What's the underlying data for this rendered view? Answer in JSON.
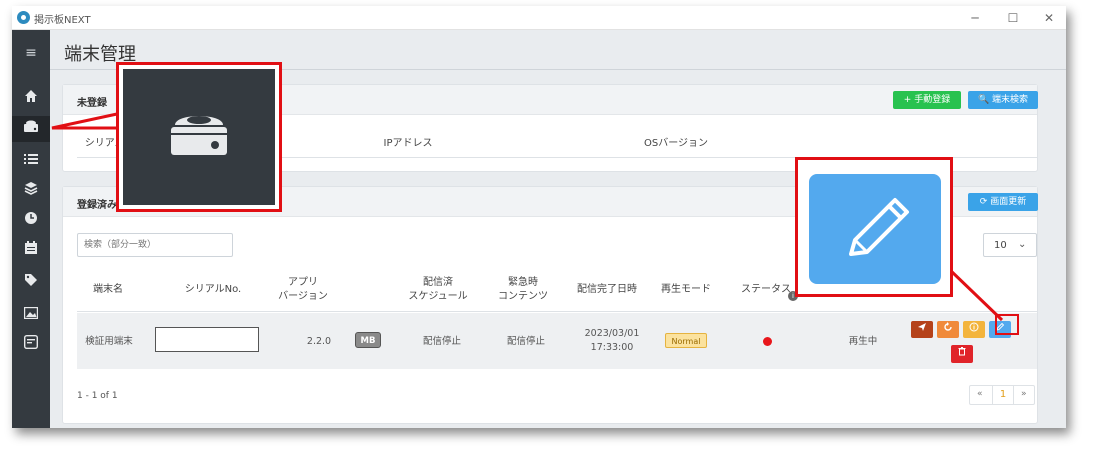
{
  "window": {
    "title": "掲示板NEXT",
    "minimize": "─",
    "maximize": "☐",
    "close": "✕"
  },
  "sidebar": {
    "menu": "≡",
    "items": [
      "home-icon",
      "device-icon",
      "list-icon",
      "layers-icon",
      "clock-icon",
      "calendar-icon",
      "tag-icon",
      "image-icon",
      "note-icon"
    ]
  },
  "header": {
    "title": "端末管理"
  },
  "unregistered": {
    "title": "未登録",
    "add_button": "+ 手動登録",
    "search_button": "🔍 端末検索",
    "columns": [
      "シリアルNo.",
      "IPアドレス",
      "OSバージョン"
    ]
  },
  "registered": {
    "title": "登録済み",
    "refresh_button": "⟳ 画面更新",
    "search_placeholder": "検索（部分一致）",
    "page_size": "10",
    "columns": [
      "端末名",
      "シリアルNo.",
      "アプリ\nバージョン",
      "配信済\nスケジュール",
      "緊急時\nコンテンツ",
      "配信完了日時",
      "再生モード",
      "ステータス"
    ],
    "row": {
      "name": "検証用端末",
      "serial": "",
      "app_version": "2.2.0",
      "mb_badge": "MB",
      "schedule": "配信停止",
      "emergency": "配信停止",
      "completed_date": "2023/03/01",
      "completed_time": "17:33:00",
      "mode": "Normal",
      "status_color": "#e8161b",
      "playback": "再生中"
    },
    "pagination_info": "1 - 1 of 1",
    "pages": {
      "prev": "«",
      "current": "1",
      "next": "»"
    }
  },
  "colors": {
    "sidebar_bg": "#343a40",
    "green": "#28c24f",
    "blue": "#3aa3e8",
    "red": "#e10f14",
    "brown": "#b5421a",
    "orange": "#f08a3a",
    "yellow": "#f3b43c",
    "callout_icon_bg": "#53a9ee"
  }
}
